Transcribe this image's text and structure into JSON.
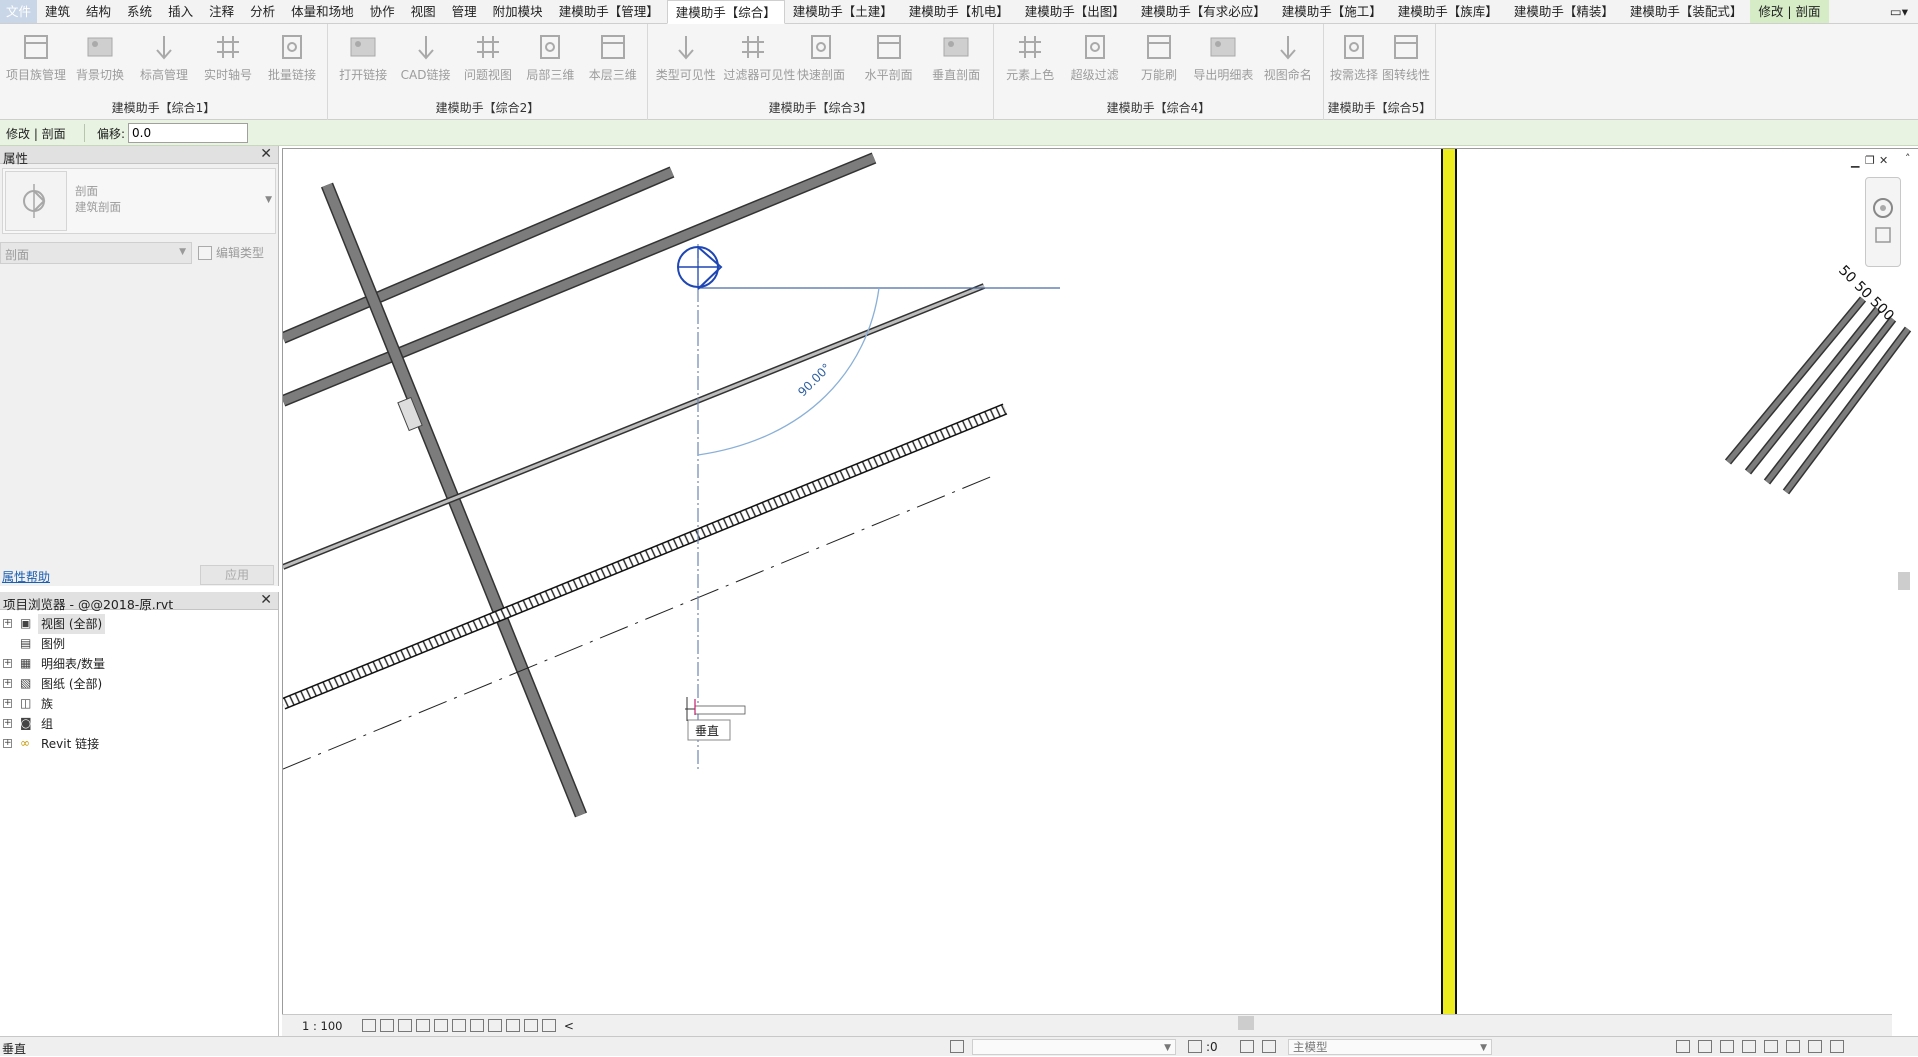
{
  "menu": {
    "file": "文件",
    "tabs": [
      "建筑",
      "结构",
      "系统",
      "插入",
      "注释",
      "分析",
      "体量和场地",
      "协作",
      "视图",
      "管理",
      "附加模块",
      "建模助手【管理】",
      "建模助手【综合】",
      "建模助手【土建】",
      "建模助手【机电】",
      "建模助手【出图】",
      "建模助手【有求必应】",
      "建模助手【施工】",
      "建模助手【族库】",
      "建模助手【精装】",
      "建模助手【装配式】",
      "修改 | 剖面"
    ],
    "active_tab": "建模助手【综合】",
    "context_tab": "修改 | 剖面",
    "more": "▭▾"
  },
  "ribbon": {
    "panels": [
      {
        "title": "建模助手【综合1】",
        "tools": [
          {
            "label": "项目族管理",
            "icon": "family-manager-icon"
          },
          {
            "label": "背景切换",
            "icon": "background-switch-icon"
          },
          {
            "label": "标高管理",
            "icon": "level-manager-icon"
          },
          {
            "label": "实时轴号",
            "icon": "grid-number-icon"
          },
          {
            "label": "批量链接",
            "icon": "batch-link-icon"
          }
        ]
      },
      {
        "title": "建模助手【综合2】",
        "tools": [
          {
            "label": "打开链接",
            "icon": "open-link-icon"
          },
          {
            "label": "CAD链接",
            "icon": "cad-link-icon"
          },
          {
            "label": "问题视图",
            "icon": "issue-view-icon"
          },
          {
            "label": "局部三维",
            "icon": "local-3d-icon"
          },
          {
            "label": "本层三维",
            "icon": "floor-3d-icon"
          }
        ]
      },
      {
        "title": "建模助手【综合3】",
        "tools": [
          {
            "label": "类型可见性",
            "icon": "type-visibility-icon"
          },
          {
            "label": "过滤器可见性",
            "icon": "filter-visibility-icon"
          },
          {
            "label": "快速剖面",
            "icon": "quick-section-icon"
          },
          {
            "label": "水平剖面",
            "icon": "horizontal-section-icon"
          },
          {
            "label": "垂直剖面",
            "icon": "vertical-section-icon"
          }
        ]
      },
      {
        "title": "建模助手【综合4】",
        "tools": [
          {
            "label": "元素上色",
            "icon": "element-color-icon"
          },
          {
            "label": "超级过滤",
            "icon": "super-filter-icon"
          },
          {
            "label": "万能刷",
            "icon": "brush-icon"
          },
          {
            "label": "导出明细表",
            "icon": "export-schedule-icon"
          },
          {
            "label": "视图命名",
            "icon": "view-name-icon"
          }
        ]
      },
      {
        "title": "建模助手【综合5】",
        "tools": [
          {
            "label": "按需选择",
            "icon": "select-filter-icon"
          },
          {
            "label": "图转线性",
            "icon": "image-to-line-icon"
          }
        ]
      }
    ]
  },
  "options_bar": {
    "context": "修改 | 剖面",
    "offset_label": "偏移:",
    "offset_value": "0.0"
  },
  "properties": {
    "title": "属性",
    "type_name": "剖面",
    "type_sub": "建筑剖面",
    "instance_selector": "剖面",
    "edit_type": "编辑类型",
    "help": "属性帮助",
    "apply": "应用"
  },
  "project_browser": {
    "title": "项目浏览器 - @@2018-原.rvt",
    "items": [
      {
        "label": "视图 (全部)",
        "icon": "views-icon",
        "expand": true,
        "selected": true
      },
      {
        "label": "图例",
        "icon": "legend-icon",
        "expand": false
      },
      {
        "label": "明细表/数量",
        "icon": "schedule-icon",
        "expand": true
      },
      {
        "label": "图纸 (全部)",
        "icon": "sheet-icon",
        "expand": true
      },
      {
        "label": "族",
        "icon": "family-icon",
        "expand": true
      },
      {
        "label": "组",
        "icon": "group-icon",
        "expand": true
      },
      {
        "label": "Revit 链接",
        "icon": "revit-link-icon",
        "expand": true
      }
    ]
  },
  "canvas": {
    "angle_label": "90.00°",
    "tooltip": "垂直",
    "dimension_label": "50 50 500"
  },
  "view_control": {
    "scale": "1 : 100",
    "collapse": "<"
  },
  "status": {
    "message": "垂直",
    "selection_count": ":0",
    "workset": "主模型"
  },
  "colors": {
    "accent_green": "#e8f3e1",
    "yellow_line": "#ecec1e",
    "section_blue": "#1e46b4"
  }
}
